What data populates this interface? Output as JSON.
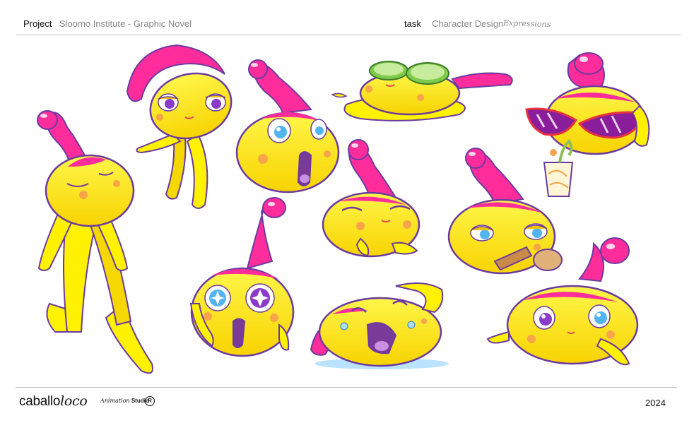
{
  "header": {
    "project_label": "Project",
    "project_value": "Sloomo Institute - Graphic Novel",
    "task_label": "task",
    "task_value": "Character Design",
    "task_note": "Expressions"
  },
  "colors": {
    "body_yellow": "#fff200",
    "shade_yellow": "#f5c400",
    "hair_pink": "#ff2d9b",
    "outline": "#6b3aa0",
    "cheek_orange": "#f7a44a",
    "iris_blue": "#53b4f2",
    "tear_blue": "#a9dcff"
  },
  "sheet": {
    "character_poses": [
      "standing-eyes-closed",
      "leaning-wink",
      "surprised-open-mouth",
      "spa-cucumber-melted",
      "sunglasses-drinking",
      "happy-squint",
      "starry-eyed-shocked",
      "lying-crying",
      "smug-holding-bottle",
      "chin-rest-dreamy"
    ]
  },
  "footer": {
    "logo_main": "caballo",
    "logo_italic": "loco",
    "studio_italic": "Animation",
    "studio_bold": "Studio",
    "registered_mark": "R",
    "year": "2024"
  }
}
